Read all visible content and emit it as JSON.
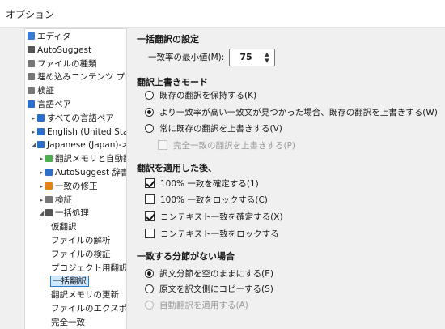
{
  "window": {
    "title": "オプション"
  },
  "sidebar": {
    "items": [
      {
        "label": "エディタ",
        "icon": "pencil-icon",
        "level": 0,
        "arrow": "",
        "color": "#3a7bd5"
      },
      {
        "label": "AutoSuggest",
        "icon": "autosuggest-icon",
        "level": 0,
        "arrow": "",
        "color": "#555555"
      },
      {
        "label": "ファイルの種類",
        "icon": "file-types-icon",
        "level": 0,
        "arrow": "",
        "color": "#777777"
      },
      {
        "label": "埋め込みコンテンツ プロセ",
        "icon": "embedded-content-icon",
        "level": 0,
        "arrow": "",
        "color": "#777777"
      },
      {
        "label": "検証",
        "icon": "verification-icon",
        "level": 0,
        "arrow": "",
        "color": "#777777"
      },
      {
        "label": "言語ペア",
        "icon": "language-pairs-icon",
        "level": 0,
        "arrow": "",
        "color": "#2a6fc9"
      },
      {
        "label": "すべての言語ペア",
        "icon": "all-language-pairs-icon",
        "level": 1,
        "arrow": "▸",
        "color": "#2a6fc9"
      },
      {
        "label": "English (United State",
        "icon": "language-pair-icon",
        "level": 1,
        "arrow": "▸",
        "color": "#2a6fc9"
      },
      {
        "label": "Japanese (Japan)->En",
        "icon": "language-pair-icon",
        "level": 1,
        "arrow": "◢",
        "color": "#2a6fc9"
      },
      {
        "label": "翻訳メモリと自動翻",
        "icon": "translation-memory-icon",
        "level": 2,
        "arrow": "▸",
        "color": "#4caf50"
      },
      {
        "label": "AutoSuggest 辞書",
        "icon": "dictionary-icon",
        "level": 2,
        "arrow": "▸",
        "color": "#2a6fc9"
      },
      {
        "label": "一致の修正",
        "icon": "fuzzy-repair-icon",
        "level": 2,
        "arrow": "▸",
        "color": "#e6820e"
      },
      {
        "label": "検証",
        "icon": "verification-icon",
        "level": 2,
        "arrow": "▸",
        "color": "#777777"
      },
      {
        "label": "一括処理",
        "icon": "batch-processing-icon",
        "level": 2,
        "arrow": "◢",
        "color": "#555555"
      },
      {
        "label": "仮翻訳",
        "icon": "",
        "level": 3,
        "arrow": "",
        "color": ""
      },
      {
        "label": "ファイルの解析",
        "icon": "",
        "level": 3,
        "arrow": "",
        "color": ""
      },
      {
        "label": "ファイルの検証",
        "icon": "",
        "level": 3,
        "arrow": "",
        "color": ""
      },
      {
        "label": "プロジェクト用翻訳メ",
        "icon": "",
        "level": 3,
        "arrow": "",
        "color": ""
      },
      {
        "label": "一括翻訳",
        "icon": "",
        "level": 3,
        "arrow": "",
        "color": "",
        "selected": true
      },
      {
        "label": "翻訳メモリの更新",
        "icon": "",
        "level": 3,
        "arrow": "",
        "color": ""
      },
      {
        "label": "ファイルのエクスポート",
        "icon": "",
        "level": 3,
        "arrow": "",
        "color": ""
      },
      {
        "label": "完全一致",
        "icon": "",
        "level": 3,
        "arrow": "",
        "color": ""
      }
    ]
  },
  "settings": {
    "section_batch": "一括翻訳の設定",
    "min_match_label": "一致率の最小値(M):",
    "min_match_value": "75",
    "section_overwrite": "翻訳上書きモード",
    "overwrite_options": [
      {
        "label": "既存の翻訳を保持する(K)",
        "checked": false
      },
      {
        "label": "より一致率が高い一致文が見つかった場合、既存の翻訳を上書きする(W)",
        "checked": true
      },
      {
        "label": "常に既存の翻訳を上書きする(V)",
        "checked": false
      }
    ],
    "overwrite_perfect_label": "完全一致の翻訳を上書きする(P)",
    "section_after": "翻訳を適用した後、",
    "after_options": [
      {
        "label": "100% 一致を確定する(1)",
        "checked": true
      },
      {
        "label": "100% 一致をロックする(C)",
        "checked": false
      },
      {
        "label": "コンテキスト一致を確定する(X)",
        "checked": true
      },
      {
        "label": "コンテキスト一致をロックする",
        "checked": false
      }
    ],
    "section_nomatch": "一致する分節がない場合",
    "nomatch_options": [
      {
        "label": "訳文分節を空のままにする(E)",
        "checked": true,
        "disabled": false
      },
      {
        "label": "原文を訳文側にコピーする(S)",
        "checked": false,
        "disabled": false
      },
      {
        "label": "自動翻訳を適用する(A)",
        "checked": false,
        "disabled": true
      }
    ]
  }
}
